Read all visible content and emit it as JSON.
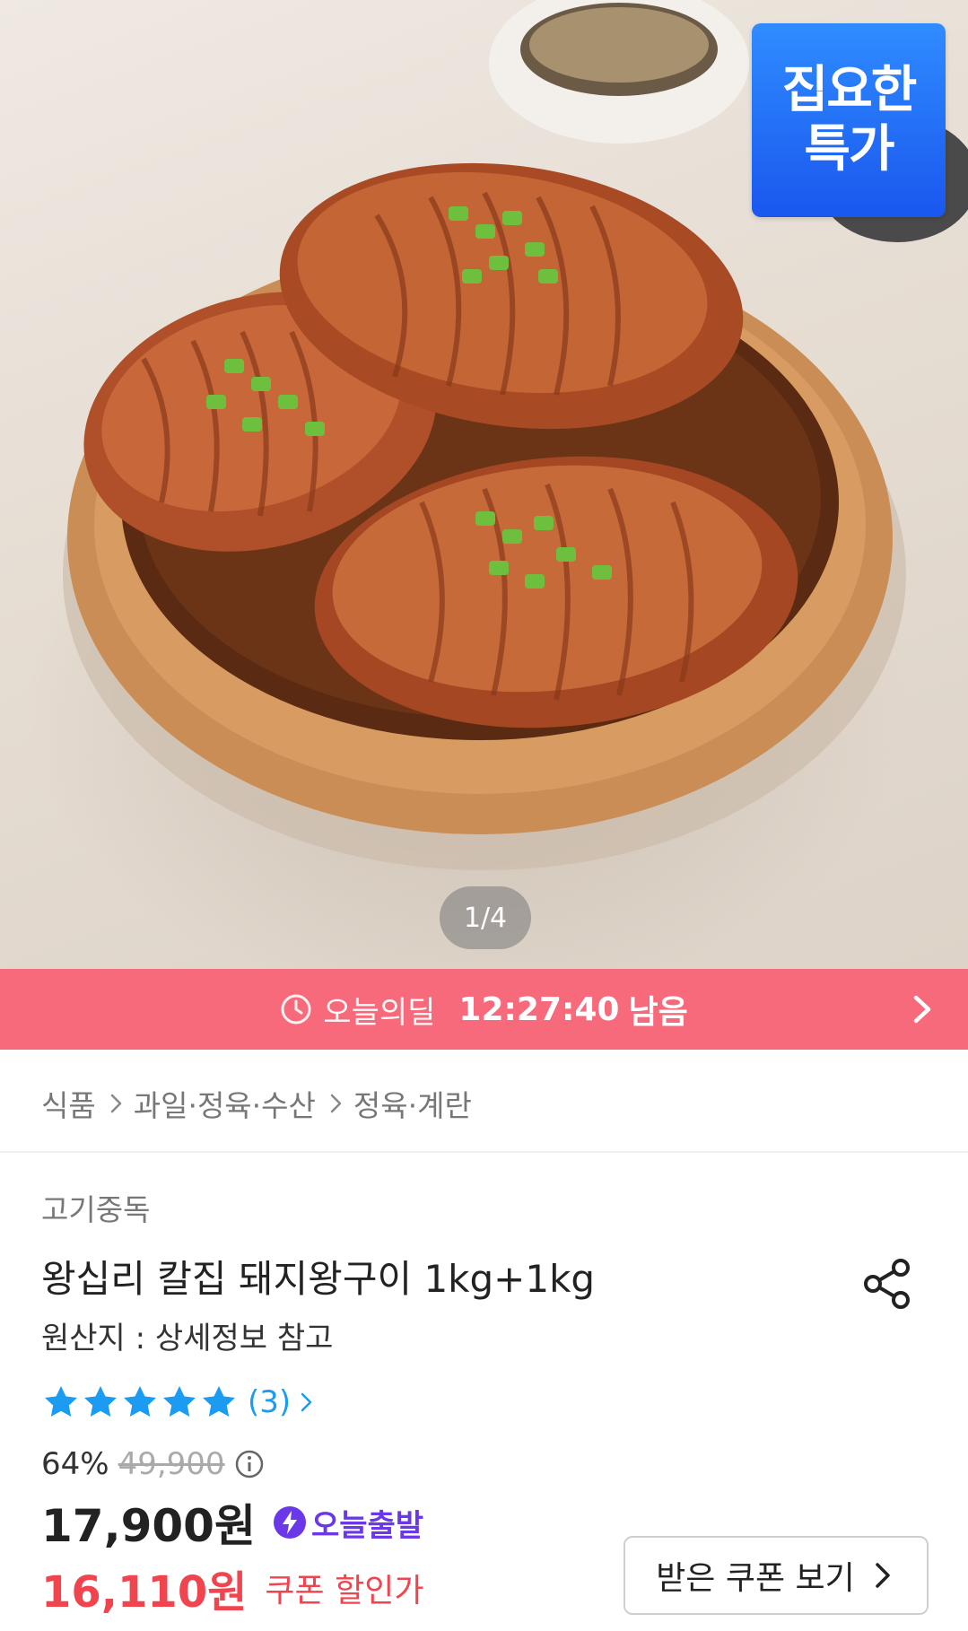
{
  "hero": {
    "badge_line1": "집요한",
    "badge_line2": "특가",
    "page_indicator": "1/4",
    "current_image": 1,
    "total_images": 4
  },
  "deal": {
    "label": "오늘의딜",
    "time_left": "12:27:40",
    "suffix": "남음",
    "color": "#f76a7b"
  },
  "breadcrumb": {
    "items": [
      "식품",
      "과일·정육·수산",
      "정육·계란"
    ]
  },
  "product": {
    "brand": "고기중독",
    "title": "왕십리 칼집 돼지왕구이 1kg+1kg",
    "origin": "원산지 : 상세정보 참고",
    "rating_stars": 5,
    "review_count": "(3)",
    "discount_rate": "64%",
    "original_price": "49,900",
    "sale_price": "17,900원",
    "shipping_badge": "오늘출발",
    "coupon_price": "16,110원",
    "coupon_label": "쿠폰 할인가",
    "coupon_button": "받은 쿠폰 보기"
  },
  "colors": {
    "accent_blue": "#1b9cf2",
    "coupon_red": "#f0444e",
    "shipping_purple": "#6a38e8",
    "badge_blue": "#2f8cff"
  },
  "icons": [
    "clock-icon",
    "chevron-right-icon",
    "share-icon",
    "star-icon",
    "info-icon",
    "lightning-icon"
  ]
}
